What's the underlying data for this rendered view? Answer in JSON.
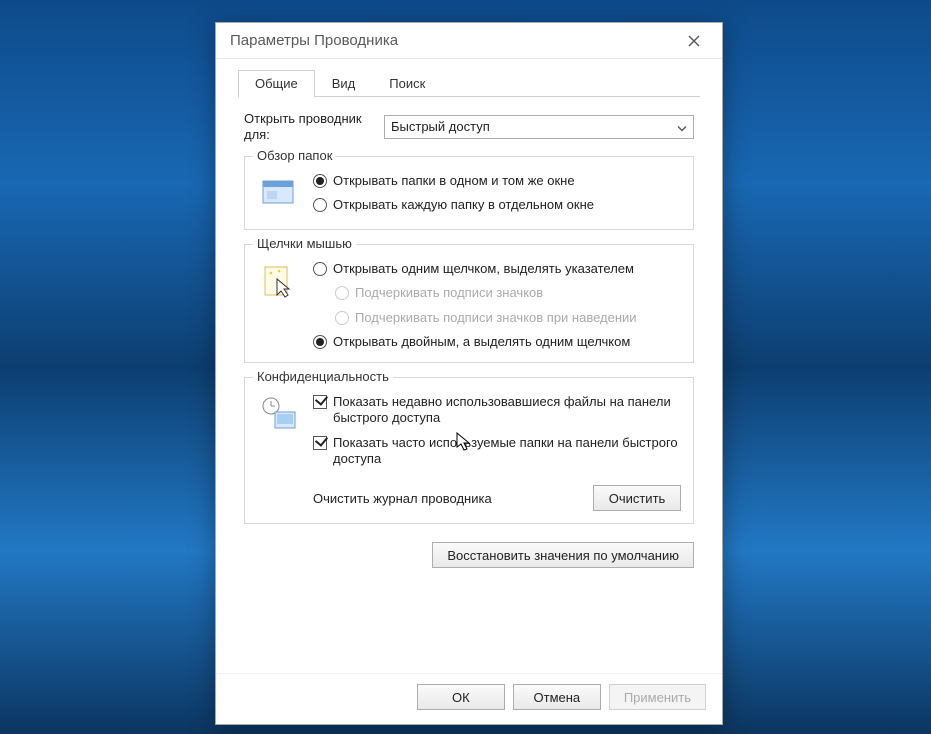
{
  "window": {
    "title": "Параметры Проводника"
  },
  "tabs": {
    "general": "Общие",
    "view": "Вид",
    "search": "Поиск"
  },
  "open": {
    "label": "Открыть проводник для:",
    "value": "Быстрый доступ"
  },
  "browse": {
    "legend": "Обзор папок",
    "same_window": "Открывать папки в одном и том же окне",
    "new_window": "Открывать каждую папку в отдельном окне"
  },
  "clicks": {
    "legend": "Щелчки мышью",
    "single": "Открывать одним щелчком, выделять указателем",
    "underline_always": "Подчеркивать подписи значков",
    "underline_hover": "Подчеркивать подписи значков при наведении",
    "double": "Открывать двойным, а выделять одним щелчком"
  },
  "privacy": {
    "legend": "Конфиденциальность",
    "recent_files": "Показать недавно использовавшиеся файлы на панели быстрого доступа",
    "freq_folders": "Показать часто используемые папки на панели быстрого доступа",
    "clear_label": "Очистить журнал проводника",
    "clear_button": "Очистить"
  },
  "restore_defaults": "Восстановить значения по умолчанию",
  "footer": {
    "ok": "ОК",
    "cancel": "Отмена",
    "apply": "Применить"
  }
}
